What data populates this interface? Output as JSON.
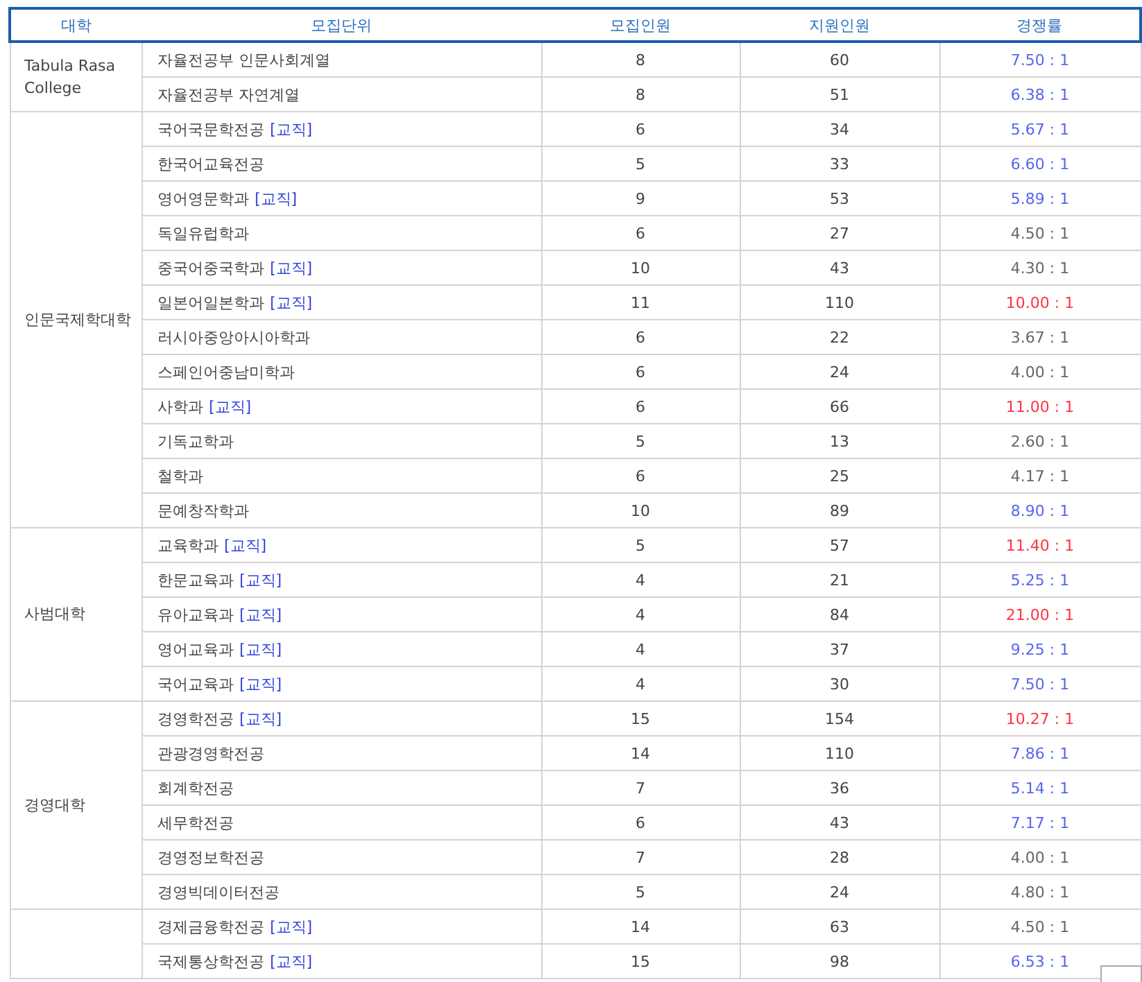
{
  "table": {
    "columns": [
      "대학",
      "모집단위",
      "모집인원",
      "지원인원",
      "경쟁률"
    ],
    "groups": [
      {
        "college": "Tabula Rasa College",
        "rows": [
          {
            "unit": "자율전공부 인문사회계열",
            "quota": "8",
            "applicants": "60",
            "ratio": "7.50 : 1",
            "color": "#5566ee"
          },
          {
            "unit": "자율전공부 자연계열",
            "quota": "8",
            "applicants": "51",
            "ratio": "6.38 : 1",
            "color": "#5566ee"
          }
        ]
      },
      {
        "college": "인문국제학대학",
        "rows": [
          {
            "unit": "국어국문학전공",
            "tag": "[교직]",
            "quota": "6",
            "applicants": "34",
            "ratio": "5.67 : 1",
            "color": "#5566ee"
          },
          {
            "unit": "한국어교육전공",
            "quota": "5",
            "applicants": "33",
            "ratio": "6.60 : 1",
            "color": "#5566ee"
          },
          {
            "unit": "영어영문학과",
            "tag": "[교직]",
            "quota": "9",
            "applicants": "53",
            "ratio": "5.89 : 1",
            "color": "#5566ee"
          },
          {
            "unit": "독일유럽학과",
            "quota": "6",
            "applicants": "27",
            "ratio": "4.50 : 1",
            "color": "#666666"
          },
          {
            "unit": "중국어중국학과",
            "tag": "[교직]",
            "quota": "10",
            "applicants": "43",
            "ratio": "4.30 : 1",
            "color": "#666666"
          },
          {
            "unit": "일본어일본학과",
            "tag": "[교직]",
            "quota": "11",
            "applicants": "110",
            "ratio": "10.00 : 1",
            "color": "#ff3344"
          },
          {
            "unit": "러시아중앙아시아학과",
            "quota": "6",
            "applicants": "22",
            "ratio": "3.67 : 1",
            "color": "#666666"
          },
          {
            "unit": "스페인어중남미학과",
            "quota": "6",
            "applicants": "24",
            "ratio": "4.00 : 1",
            "color": "#666666"
          },
          {
            "unit": "사학과",
            "tag": "[교직]",
            "quota": "6",
            "applicants": "66",
            "ratio": "11.00 : 1",
            "color": "#ff3344"
          },
          {
            "unit": "기독교학과",
            "quota": "5",
            "applicants": "13",
            "ratio": "2.60 : 1",
            "color": "#666666"
          },
          {
            "unit": "철학과",
            "quota": "6",
            "applicants": "25",
            "ratio": "4.17 : 1",
            "color": "#666666"
          },
          {
            "unit": "문예창작학과",
            "quota": "10",
            "applicants": "89",
            "ratio": "8.90 : 1",
            "color": "#5566ee"
          }
        ]
      },
      {
        "college": "사범대학",
        "rows": [
          {
            "unit": "교육학과",
            "tag": "[교직]",
            "quota": "5",
            "applicants": "57",
            "ratio": "11.40 : 1",
            "color": "#ff3344"
          },
          {
            "unit": "한문교육과",
            "tag": "[교직]",
            "quota": "4",
            "applicants": "21",
            "ratio": "5.25 : 1",
            "color": "#5566ee"
          },
          {
            "unit": "유아교육과",
            "tag": "[교직]",
            "quota": "4",
            "applicants": "84",
            "ratio": "21.00 : 1",
            "color": "#ff3344"
          },
          {
            "unit": "영어교육과",
            "tag": "[교직]",
            "quota": "4",
            "applicants": "37",
            "ratio": "9.25 : 1",
            "color": "#5566ee"
          },
          {
            "unit": "국어교육과",
            "tag": "[교직]",
            "quota": "4",
            "applicants": "30",
            "ratio": "7.50 : 1",
            "color": "#5566ee"
          }
        ]
      },
      {
        "college": "경영대학",
        "rows": [
          {
            "unit": "경영학전공",
            "tag": "[교직]",
            "quota": "15",
            "applicants": "154",
            "ratio": "10.27 : 1",
            "color": "#ff3344"
          },
          {
            "unit": "관광경영학전공",
            "quota": "14",
            "applicants": "110",
            "ratio": "7.86 : 1",
            "color": "#5566ee"
          },
          {
            "unit": "회계학전공",
            "quota": "7",
            "applicants": "36",
            "ratio": "5.14 : 1",
            "color": "#5566ee"
          },
          {
            "unit": "세무학전공",
            "quota": "6",
            "applicants": "43",
            "ratio": "7.17 : 1",
            "color": "#5566ee"
          },
          {
            "unit": "경영정보학전공",
            "quota": "7",
            "applicants": "28",
            "ratio": "4.00 : 1",
            "color": "#666666"
          },
          {
            "unit": "경영빅데이터전공",
            "quota": "5",
            "applicants": "24",
            "ratio": "4.80 : 1",
            "color": "#666666"
          }
        ]
      },
      {
        "rows": [
          {
            "unit": "경제금융학전공",
            "tag": "[교직]",
            "quota": "14",
            "applicants": "63",
            "ratio": "4.50 : 1",
            "color": "#666666"
          },
          {
            "unit": "국제통상학전공",
            "tag": "[교직]",
            "quota": "15",
            "applicants": "98",
            "ratio": "6.53 : 1",
            "color": "#5566ee"
          }
        ]
      }
    ]
  }
}
